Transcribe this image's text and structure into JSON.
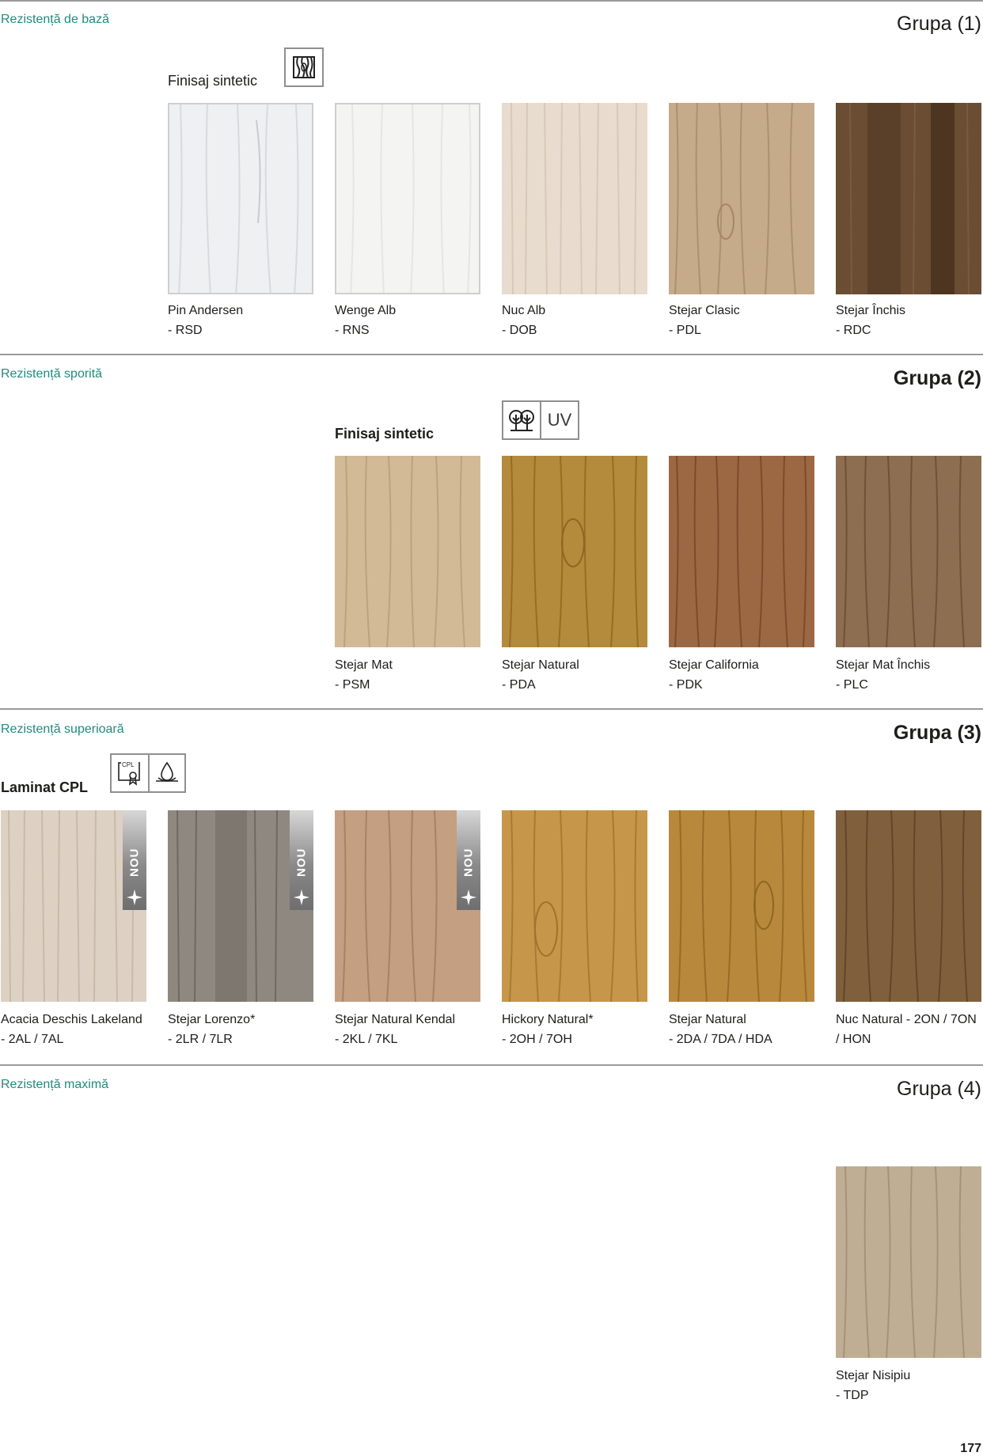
{
  "colors": {
    "accent": "#1e8c7e",
    "rule": "#9a9a9a",
    "text": "#1d1d1b"
  },
  "sections": [
    {
      "resistance": "Rezistență de bază",
      "group": "Grupa (1)",
      "finish": "Finisaj sintetic",
      "icons": [
        "wood-grain-icon"
      ],
      "swatches": [
        {
          "name": "Pin Andersen",
          "code": "- RSD",
          "base": "#eef0f2",
          "grain": "#d6dbe0"
        },
        {
          "name": "Wenge Alb",
          "code": "- RNS",
          "base": "#f4f4f3",
          "grain": "#e5e5e2"
        },
        {
          "name": "Nuc Alb",
          "code": "- DOB",
          "base": "#e8dccf",
          "grain": "#d8c9b8"
        },
        {
          "name": "Stejar Clasic",
          "code": "- PDL",
          "base": "#c5ab89",
          "grain": "#ad916d"
        },
        {
          "name": "Stejar Închis",
          "code": "- RDC",
          "base": "#6b4d34",
          "grain": "#4e3522"
        }
      ]
    },
    {
      "resistance": "Rezistență sporită",
      "group": "Grupa (2)",
      "finish": "Finisaj sintetic",
      "icons": [
        "trees-icon",
        "UV"
      ],
      "swatches": [
        {
          "name": "Stejar Mat",
          "code": "- PSM",
          "base": "#d2ba97",
          "grain": "#bea27b"
        },
        {
          "name": "Stejar Natural",
          "code": "- PDA",
          "base": "#b48a3c",
          "grain": "#966d25"
        },
        {
          "name": "Stejar California",
          "code": "- PDK",
          "base": "#9c6844",
          "grain": "#7c4b2c"
        },
        {
          "name": "Stejar Mat Închis",
          "code": "- PLC",
          "base": "#8d6e51",
          "grain": "#6e5238"
        }
      ]
    },
    {
      "resistance": "Rezistență superioară",
      "group": "Grupa (3)",
      "finish": "Laminat CPL",
      "icons": [
        "cpl-certificate-icon",
        "water-drop-icon"
      ],
      "badge": "NOU",
      "swatches": [
        {
          "name": "Acacia Deschis Lakeland",
          "code": "- 2AL / 7AL",
          "base": "#ddd1c3",
          "grain": "#c9baa8",
          "new": true
        },
        {
          "name": "Stejar Lorenzo*",
          "code": "- 2LR / 7LR",
          "base": "#8e8880",
          "grain": "#6f6961",
          "new": true
        },
        {
          "name": "Stejar Natural Kendal",
          "code": "- 2KL / 7KL",
          "base": "#c59f81",
          "grain": "#a98265",
          "new": true
        },
        {
          "name": "Hickory Natural*",
          "code": "- 2OH / 7OH",
          "base": "#c6974a",
          "grain": "#a87a33"
        },
        {
          "name": "Stejar Natural",
          "code": "- 2DA / 7DA / HDA",
          "base": "#b8893c",
          "grain": "#976c27"
        },
        {
          "name": "Nuc Natural - 2ON / 7ON",
          "code": "/ HON",
          "base": "#80603c",
          "grain": "#624628"
        }
      ]
    },
    {
      "resistance": "Rezistență maximă",
      "group": "Grupa (4)",
      "swatches": [
        {
          "name": "Stejar Nisipiu",
          "code": "- TDP",
          "base": "#c0ae94",
          "grain": "#a5927a"
        }
      ]
    }
  ],
  "page_number": "177"
}
